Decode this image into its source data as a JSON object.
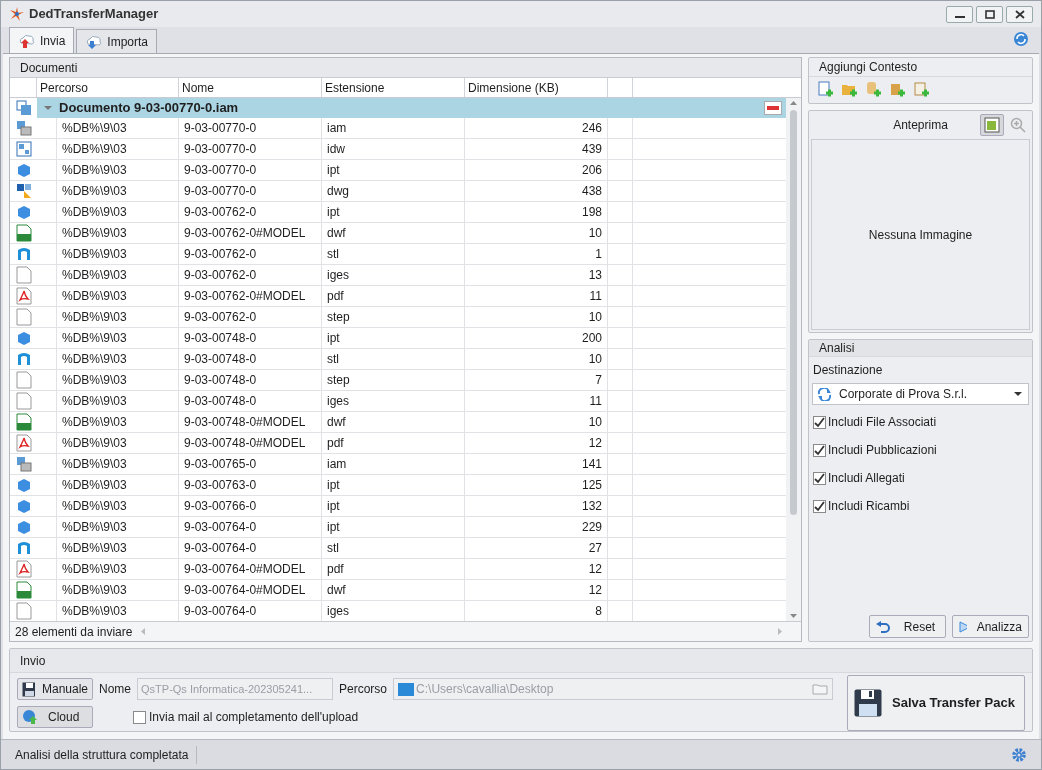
{
  "window": {
    "title": "DedTransferManager"
  },
  "tabs": [
    {
      "label": "Invia",
      "selected": true,
      "kind": "upload"
    },
    {
      "label": "Importa",
      "selected": false,
      "kind": "download"
    }
  ],
  "documents": {
    "title": "Documenti",
    "columns": [
      "Percorso",
      "Nome",
      "Estensione",
      "Dimensione (KB)"
    ],
    "group": {
      "label": "Documento 9-03-00770-0.iam",
      "expanded": true
    },
    "rows": [
      {
        "kind": "assembly",
        "path": "%DB%\\9\\03",
        "name": "9-03-00770-0",
        "ext": "iam",
        "size": "246"
      },
      {
        "kind": "drawing",
        "path": "%DB%\\9\\03",
        "name": "9-03-00770-0",
        "ext": "idw",
        "size": "439"
      },
      {
        "kind": "part",
        "path": "%DB%\\9\\03",
        "name": "9-03-00770-0",
        "ext": "ipt",
        "size": "206"
      },
      {
        "kind": "dwg",
        "path": "%DB%\\9\\03",
        "name": "9-03-00770-0",
        "ext": "dwg",
        "size": "438"
      },
      {
        "kind": "part",
        "path": "%DB%\\9\\03",
        "name": "9-03-00762-0",
        "ext": "ipt",
        "size": "198"
      },
      {
        "kind": "dwf",
        "path": "%DB%\\9\\03",
        "name": "9-03-00762-0#MODEL",
        "ext": "dwf",
        "size": "10"
      },
      {
        "kind": "stl",
        "path": "%DB%\\9\\03",
        "name": "9-03-00762-0",
        "ext": "stl",
        "size": "1"
      },
      {
        "kind": "generic",
        "path": "%DB%\\9\\03",
        "name": "9-03-00762-0",
        "ext": "iges",
        "size": "13"
      },
      {
        "kind": "pdf",
        "path": "%DB%\\9\\03",
        "name": "9-03-00762-0#MODEL",
        "ext": "pdf",
        "size": "11"
      },
      {
        "kind": "generic",
        "path": "%DB%\\9\\03",
        "name": "9-03-00762-0",
        "ext": "step",
        "size": "10"
      },
      {
        "kind": "part",
        "path": "%DB%\\9\\03",
        "name": "9-03-00748-0",
        "ext": "ipt",
        "size": "200"
      },
      {
        "kind": "stl",
        "path": "%DB%\\9\\03",
        "name": "9-03-00748-0",
        "ext": "stl",
        "size": "10"
      },
      {
        "kind": "generic",
        "path": "%DB%\\9\\03",
        "name": "9-03-00748-0",
        "ext": "step",
        "size": "7"
      },
      {
        "kind": "generic",
        "path": "%DB%\\9\\03",
        "name": "9-03-00748-0",
        "ext": "iges",
        "size": "11"
      },
      {
        "kind": "dwf",
        "path": "%DB%\\9\\03",
        "name": "9-03-00748-0#MODEL",
        "ext": "dwf",
        "size": "10"
      },
      {
        "kind": "pdf",
        "path": "%DB%\\9\\03",
        "name": "9-03-00748-0#MODEL",
        "ext": "pdf",
        "size": "12"
      },
      {
        "kind": "assembly",
        "path": "%DB%\\9\\03",
        "name": "9-03-00765-0",
        "ext": "iam",
        "size": "141"
      },
      {
        "kind": "part",
        "path": "%DB%\\9\\03",
        "name": "9-03-00763-0",
        "ext": "ipt",
        "size": "125"
      },
      {
        "kind": "part",
        "path": "%DB%\\9\\03",
        "name": "9-03-00766-0",
        "ext": "ipt",
        "size": "132"
      },
      {
        "kind": "part",
        "path": "%DB%\\9\\03",
        "name": "9-03-00764-0",
        "ext": "ipt",
        "size": "229"
      },
      {
        "kind": "stl",
        "path": "%DB%\\9\\03",
        "name": "9-03-00764-0",
        "ext": "stl",
        "size": "27"
      },
      {
        "kind": "pdf",
        "path": "%DB%\\9\\03",
        "name": "9-03-00764-0#MODEL",
        "ext": "pdf",
        "size": "12"
      },
      {
        "kind": "dwf",
        "path": "%DB%\\9\\03",
        "name": "9-03-00764-0#MODEL",
        "ext": "dwf",
        "size": "12"
      },
      {
        "kind": "generic",
        "path": "%DB%\\9\\03",
        "name": "9-03-00764-0",
        "ext": "iges",
        "size": "8"
      }
    ],
    "footer": "28 elementi da inviare"
  },
  "context": {
    "title": "Aggiungi Contesto"
  },
  "preview": {
    "title": "Anteprima",
    "empty_text": "Nessuna Immagine"
  },
  "analysis": {
    "title": "Analisi",
    "destination_label": "Destinazione",
    "destination": "Corporate di Prova S.r.l.",
    "options": [
      {
        "label": "Includi File Associati",
        "checked": true
      },
      {
        "label": "Includi Pubblicazioni",
        "checked": true
      },
      {
        "label": "Includi Allegati",
        "checked": true
      },
      {
        "label": "Includi Ricambi",
        "checked": true
      }
    ],
    "buttons": [
      "Reset",
      "Analizza"
    ]
  },
  "send": {
    "title": "Invio",
    "manual_button": "Manuale",
    "cloud_button": "Cloud",
    "name_label": "Nome",
    "name_value": "QsTP-Qs Informatica-202305241...",
    "path_label": "Percorso",
    "path_value": "C:\\Users\\cavallia\\Desktop",
    "mail_option": {
      "label": "Invia mail al completamento dell'upload",
      "checked": false
    },
    "save_button": "Salva Transfer Pack"
  },
  "status_bar": {
    "text": "Analisi della struttura completata"
  }
}
